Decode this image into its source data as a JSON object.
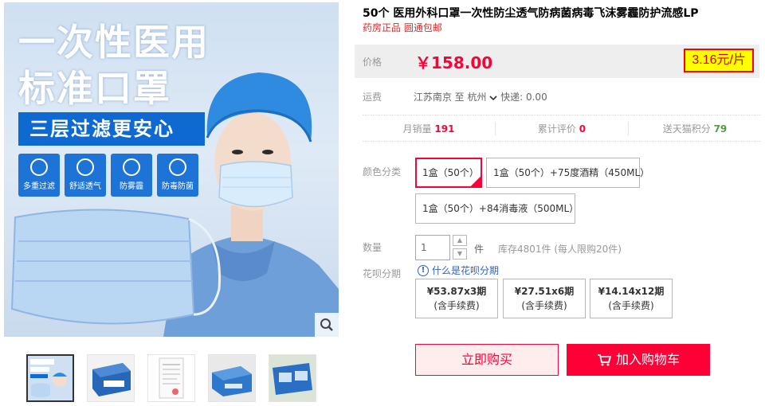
{
  "gallery": {
    "headline_line1": "一次性医用",
    "headline_line2": "标准口罩",
    "ribbon": "三层过滤更安心",
    "features": [
      "多重过滤",
      "舒适透气",
      "防雾霾",
      "防毒防菌"
    ],
    "zoom_icon": "search-icon"
  },
  "product": {
    "title": "50个 医用外科口罩一次性防尘透气防病菌病毒飞沫雾霾防护流感LP",
    "subtitle": "药房正品 圆通包邮"
  },
  "price": {
    "label": "价格",
    "value": "￥158.00",
    "unit_price": "3.16元/片"
  },
  "shipping": {
    "label": "运费",
    "text": "江苏南京  至 杭州",
    "dropdown_icon": "chevron-down-icon",
    "express": "快递: 0.00"
  },
  "stats": {
    "monthly_sales_label": "月销量",
    "monthly_sales": "191",
    "reviews_label": "累计评价",
    "reviews": "0",
    "points_label": "送天猫积分",
    "points": "79"
  },
  "sku": {
    "label": "颜色分类",
    "options": [
      "1盒（50个）",
      "1盒（50个）+75度酒精（450ML）",
      "1盒（50个）+84消毒液（500ML）"
    ],
    "selected_index": 0
  },
  "quantity": {
    "label": "数量",
    "value": "1",
    "unit": "件",
    "stock": "库存4801件  (每人限购20件)"
  },
  "huabei": {
    "label": "花呗分期",
    "link": "什么是花呗分期",
    "plans": [
      {
        "amount": "¥53.87x3期",
        "note": "(含手续费)"
      },
      {
        "amount": "¥27.51x6期",
        "note": "(含手续费)"
      },
      {
        "amount": "¥14.14x12期",
        "note": "(含手续费)"
      }
    ]
  },
  "actions": {
    "buy_now": "立即购买",
    "add_to_cart": "加入购物车",
    "cart_icon": "cart-icon"
  },
  "colors": {
    "accent": "#ff0036",
    "link": "#2a62c8",
    "brand_blue": "#0e6ad1"
  }
}
